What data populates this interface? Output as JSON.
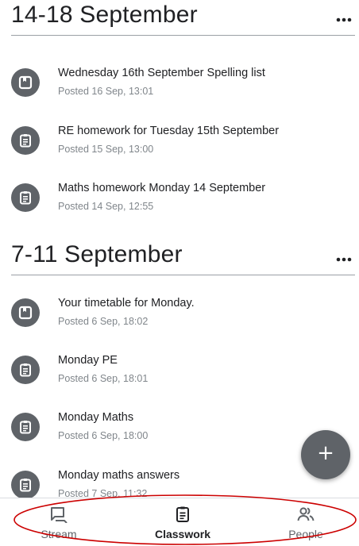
{
  "topics": [
    {
      "title": "14-18 September",
      "items": [
        {
          "title": "Wednesday 16th September Spelling list",
          "meta": "Posted 16 Sep, 13:01",
          "icon": "material-icon"
        },
        {
          "title": "RE homework for Tuesday 15th September",
          "meta": "Posted 15 Sep, 13:00",
          "icon": "assignment-icon"
        },
        {
          "title": "Maths homework Monday 14 September",
          "meta": "Posted 14 Sep, 12:55",
          "icon": "assignment-icon"
        }
      ]
    },
    {
      "title": "7-11 September",
      "items": [
        {
          "title": "Your timetable for Monday.",
          "meta": "Posted 6 Sep, 18:02",
          "icon": "material-icon"
        },
        {
          "title": "Monday PE",
          "meta": "Posted 6 Sep, 18:01",
          "icon": "assignment-icon"
        },
        {
          "title": "Monday Maths",
          "meta": "Posted 6 Sep, 18:00",
          "icon": "assignment-icon"
        },
        {
          "title": "Monday maths answers",
          "meta": "Posted 7 Sep, 11:32",
          "icon": "assignment-icon"
        }
      ]
    }
  ],
  "fab": {
    "label": "+",
    "icon": "add-icon"
  },
  "bottom_nav": {
    "items": [
      {
        "label": "Stream",
        "icon": "stream-icon",
        "active": false
      },
      {
        "label": "Classwork",
        "icon": "classwork-icon",
        "active": true
      },
      {
        "label": "People",
        "icon": "people-icon",
        "active": false
      }
    ]
  },
  "colors": {
    "icon_bg": "#5f6368",
    "text_primary": "#202124",
    "text_secondary": "#80868b",
    "divider": "#9aa0a6",
    "annotation": "#cc0000"
  }
}
